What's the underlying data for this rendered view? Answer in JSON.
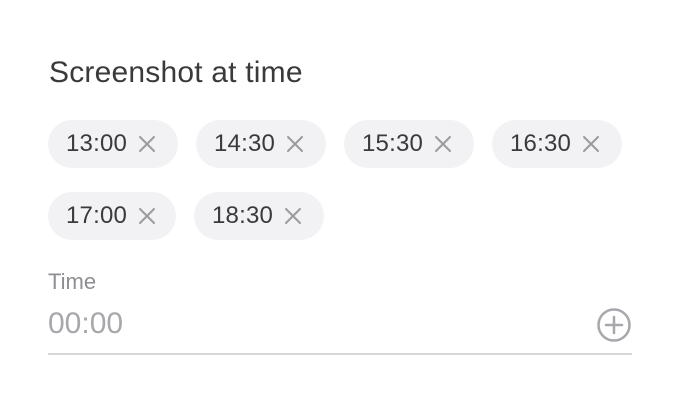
{
  "section": {
    "title": "Screenshot at time"
  },
  "chips": [
    {
      "label": "13:00",
      "remove_icon": "close-icon"
    },
    {
      "label": "14:30",
      "remove_icon": "close-icon"
    },
    {
      "label": "15:30",
      "remove_icon": "close-icon"
    },
    {
      "label": "16:30",
      "remove_icon": "close-icon"
    },
    {
      "label": "17:00",
      "remove_icon": "close-icon"
    },
    {
      "label": "18:30",
      "remove_icon": "close-icon"
    }
  ],
  "time_field": {
    "label": "Time",
    "value": "",
    "placeholder": "00:00",
    "add_icon": "plus-circle-icon"
  },
  "colors": {
    "text": "#3a3a3c",
    "muted": "#8e8e93",
    "chip_bg": "#f2f2f4",
    "icon": "#a7a7ac",
    "divider": "#d6d6d9"
  }
}
